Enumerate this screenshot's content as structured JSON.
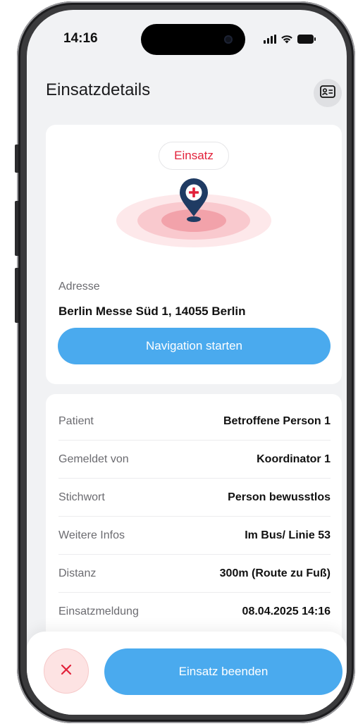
{
  "status_bar": {
    "time": "14:16"
  },
  "header": {
    "title": "Einsatzdetails",
    "profile_icon": "id-card-icon"
  },
  "location_card": {
    "badge": "Einsatz",
    "address_label": "Adresse",
    "address": "Berlin Messe Süd 1, 14055 Berlin",
    "navigation_button": "Navigation starten"
  },
  "details": [
    {
      "label": "Patient",
      "value": "Betroffene Person 1"
    },
    {
      "label": "Gemeldet von",
      "value": "Koordinator 1"
    },
    {
      "label": "Stichwort",
      "value": "Person bewusstlos"
    },
    {
      "label": "Weitere Infos",
      "value": "Im Bus/ Linie 53"
    },
    {
      "label": "Distanz",
      "value": "300m (Route zu Fuß)"
    },
    {
      "label": "Einsatzmeldung",
      "value": "08.04.2025 14:16"
    }
  ],
  "bottom_bar": {
    "cancel_icon": "close-icon",
    "end_button": "Einsatz beenden"
  },
  "colors": {
    "accent_blue": "#4aaaee",
    "alert_red": "#e2213a",
    "pin_navy": "#1f3b63",
    "screen_bg": "#f1f2f4"
  }
}
